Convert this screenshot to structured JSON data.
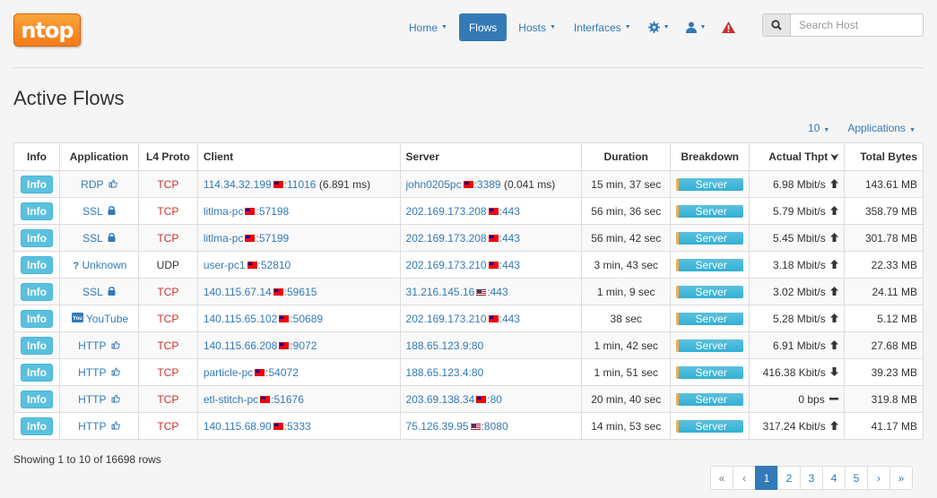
{
  "app": {
    "logo_text": "ntop"
  },
  "nav": {
    "items": [
      {
        "label": "Home",
        "active": false
      },
      {
        "label": "Flows",
        "active": true
      },
      {
        "label": "Hosts",
        "active": false
      },
      {
        "label": "Interfaces",
        "active": false
      }
    ],
    "icons": [
      "gear-icon",
      "user-icon",
      "alert-icon"
    ]
  },
  "search": {
    "placeholder": "Search Host"
  },
  "page": {
    "title": "Active Flows"
  },
  "toolbar": {
    "rows_per_page": "10",
    "applications_label": "Applications"
  },
  "table": {
    "headers": [
      "Info",
      "Application",
      "L4 Proto",
      "Client",
      "Server",
      "Duration",
      "Breakdown",
      "Actual Thpt",
      "Total Bytes"
    ],
    "rows": [
      {
        "info": "Info",
        "app": "RDP",
        "app_icon": "thumbs-up-icon",
        "proto": "TCP",
        "client": "114.34.32.199",
        "client_flag": "tw",
        "client_port": ":11016",
        "client_extra": " (6.891 ms)",
        "server": "john0205pc",
        "server_flag": "tw",
        "server_port": ":3389",
        "server_extra": " (0.041 ms)",
        "duration": "15 min, 37 sec",
        "breakdown": "Server",
        "thpt": "6.98 Mbit/s",
        "trend": "up",
        "bytes": "143.61 MB"
      },
      {
        "info": "Info",
        "app": "SSL",
        "app_icon": "lock-icon",
        "proto": "TCP",
        "client": "litlma-pc",
        "client_flag": "tw",
        "client_port": ":57198",
        "client_extra": "",
        "server": "202.169.173.208",
        "server_flag": "tw",
        "server_port": ":443",
        "server_extra": "",
        "duration": "56 min, 36 sec",
        "breakdown": "Server",
        "thpt": "5.79 Mbit/s",
        "trend": "up",
        "bytes": "358.79 MB"
      },
      {
        "info": "Info",
        "app": "SSL",
        "app_icon": "lock-icon",
        "proto": "TCP",
        "client": "litlma-pc",
        "client_flag": "tw",
        "client_port": ":57199",
        "client_extra": "",
        "server": "202.169.173.208",
        "server_flag": "tw",
        "server_port": ":443",
        "server_extra": "",
        "duration": "56 min, 42 sec",
        "breakdown": "Server",
        "thpt": "5.45 Mbit/s",
        "trend": "up",
        "bytes": "301.78 MB"
      },
      {
        "info": "Info",
        "app": "Unknown",
        "app_icon": "question-icon",
        "proto": "UDP",
        "client": "user-pc1",
        "client_flag": "tw",
        "client_port": ":52810",
        "client_extra": "",
        "server": "202.169.173.210",
        "server_flag": "tw",
        "server_port": ":443",
        "server_extra": "",
        "duration": "3 min, 43 sec",
        "breakdown": "Server",
        "thpt": "3.18 Mbit/s",
        "trend": "up",
        "bytes": "22.33 MB"
      },
      {
        "info": "Info",
        "app": "SSL",
        "app_icon": "lock-icon",
        "proto": "TCP",
        "client": "140.115.67.14",
        "client_flag": "tw",
        "client_port": ":59615",
        "client_extra": "",
        "server": "31.216.145.16",
        "server_flag": "us",
        "server_port": ":443",
        "server_extra": "",
        "duration": "1 min, 9 sec",
        "breakdown": "Server",
        "thpt": "3.02 Mbit/s",
        "trend": "up",
        "bytes": "24.11 MB"
      },
      {
        "info": "Info",
        "app": "YouTube",
        "app_icon": "youtube-icon",
        "proto": "TCP",
        "client": "140.115.65.102",
        "client_flag": "tw",
        "client_port": ":50689",
        "client_extra": "",
        "server": "202.169.173.210",
        "server_flag": "tw",
        "server_port": ":443",
        "server_extra": "",
        "duration": "38 sec",
        "breakdown": "Server",
        "thpt": "5.28 Mbit/s",
        "trend": "up",
        "bytes": "5.12 MB"
      },
      {
        "info": "Info",
        "app": "HTTP",
        "app_icon": "thumbs-up-icon",
        "proto": "TCP",
        "client": "140.115.66.208",
        "client_flag": "tw",
        "client_port": ":9072",
        "client_extra": "",
        "server": "188.65.123.9:80",
        "server_flag": "",
        "server_port": "",
        "server_extra": "",
        "duration": "1 min, 42 sec",
        "breakdown": "Server",
        "thpt": "6.91 Mbit/s",
        "trend": "up",
        "bytes": "27.68 MB"
      },
      {
        "info": "Info",
        "app": "HTTP",
        "app_icon": "thumbs-up-icon",
        "proto": "TCP",
        "client": "particle-pc",
        "client_flag": "tw",
        "client_port": ":54072",
        "client_extra": "",
        "server": "188.65.123.4:80",
        "server_flag": "",
        "server_port": "",
        "server_extra": "",
        "duration": "1 min, 51 sec",
        "breakdown": "Server",
        "thpt": "416.38 Kbit/s",
        "trend": "down",
        "bytes": "39.23 MB"
      },
      {
        "info": "Info",
        "app": "HTTP",
        "app_icon": "thumbs-up-icon",
        "proto": "TCP",
        "client": "etl-stitch-pc",
        "client_flag": "tw",
        "client_port": ":51676",
        "client_extra": "",
        "server": "203.69.138.34",
        "server_flag": "tw",
        "server_port": ":80",
        "server_extra": "",
        "duration": "20 min, 40 sec",
        "breakdown": "Server",
        "thpt": "0 bps",
        "trend": "flat",
        "bytes": "319.8 MB"
      },
      {
        "info": "Info",
        "app": "HTTP",
        "app_icon": "thumbs-up-icon",
        "proto": "TCP",
        "client": "140.115.68.90",
        "client_flag": "tw",
        "client_port": ":5333",
        "client_extra": "",
        "server": "75.126.39.95",
        "server_flag": "us",
        "server_port": ":8080",
        "server_extra": "",
        "duration": "14 min, 53 sec",
        "breakdown": "Server",
        "thpt": "317.24 Kbit/s",
        "trend": "up",
        "bytes": "41.17 MB"
      }
    ]
  },
  "footer": {
    "summary": "Showing 1 to 10 of 16698 rows"
  },
  "pagination": {
    "first": "«",
    "prev": "‹",
    "pages": [
      "1",
      "2",
      "3",
      "4",
      "5"
    ],
    "active": "1",
    "next": "›",
    "last": "»"
  }
}
